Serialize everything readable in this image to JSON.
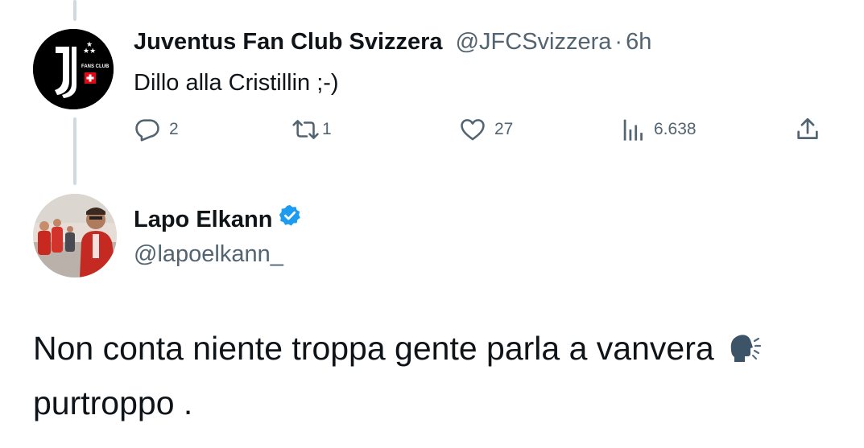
{
  "reply_tweet": {
    "author_name": "Juventus Fan Club Svizzera",
    "handle": "@JFCSvizzera",
    "separator": "·",
    "time": "6h",
    "text": "Dillo alla Cristillin ;-)",
    "avatar": {
      "icon": "juventus-fan-club-logo",
      "logo_text": "FANS CLUB",
      "background": "#000000"
    },
    "actions": {
      "reply": {
        "icon": "reply-icon",
        "count": "2"
      },
      "retweet": {
        "icon": "retweet-icon",
        "count": "1"
      },
      "like": {
        "icon": "heart-icon",
        "count": "27"
      },
      "views": {
        "icon": "views-icon",
        "count": "6.638"
      },
      "share": {
        "icon": "share-icon"
      }
    }
  },
  "main_tweet": {
    "author_name": "Lapo Elkann",
    "verified": true,
    "handle": "@lapoelkann_",
    "text": "Non conta niente troppa gente parla a vanvera",
    "emoji": "speaking-head-emoji",
    "text_continued": "purtroppo ."
  },
  "colors": {
    "text_primary": "#0f1419",
    "text_secondary": "#536471",
    "verified_blue": "#1d9bf0",
    "thread_line": "#cfd9de",
    "swiss_red": "#e30613"
  }
}
